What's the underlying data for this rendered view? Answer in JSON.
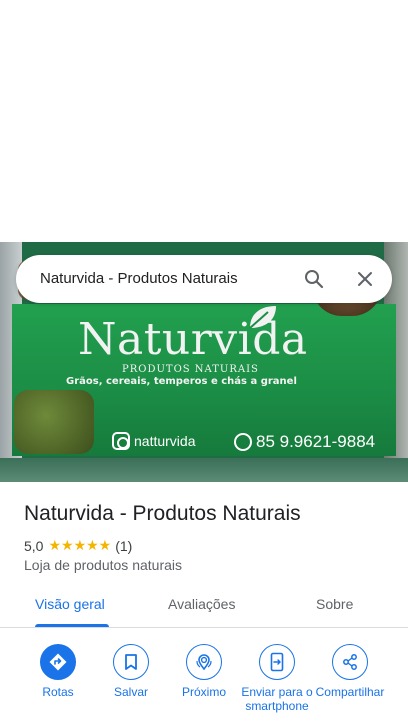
{
  "search": {
    "query": "Naturvida - Produtos Naturais"
  },
  "photo": {
    "brand": "Naturvida",
    "tagline1": "PRODUTOS NATURAIS",
    "tagline2": "Grãos, cereais, temperos e chás a granel",
    "instagram": "natturvida",
    "whatsapp": "85 9.9621-9884"
  },
  "place": {
    "title": "Naturvida - Produtos Naturais",
    "rating": "5,0",
    "stars": "★★★★★",
    "reviews": "(1)",
    "category": "Loja de produtos naturais"
  },
  "tabs": [
    {
      "label": "Visão geral",
      "active": true
    },
    {
      "label": "Avaliações",
      "active": false
    },
    {
      "label": "Sobre",
      "active": false
    }
  ],
  "actions": [
    {
      "label": "Rotas",
      "icon": "directions-icon"
    },
    {
      "label": "Salvar",
      "icon": "bookmark-icon"
    },
    {
      "label": "Próximo",
      "icon": "nearby-icon"
    },
    {
      "label": "Enviar para o smartphone",
      "icon": "send-to-phone-icon"
    },
    {
      "label": "Compartilhar",
      "icon": "share-icon"
    }
  ],
  "colors": {
    "accent": "#1a73e8",
    "star": "#f4b400",
    "banner_green": "#1b8c45"
  }
}
